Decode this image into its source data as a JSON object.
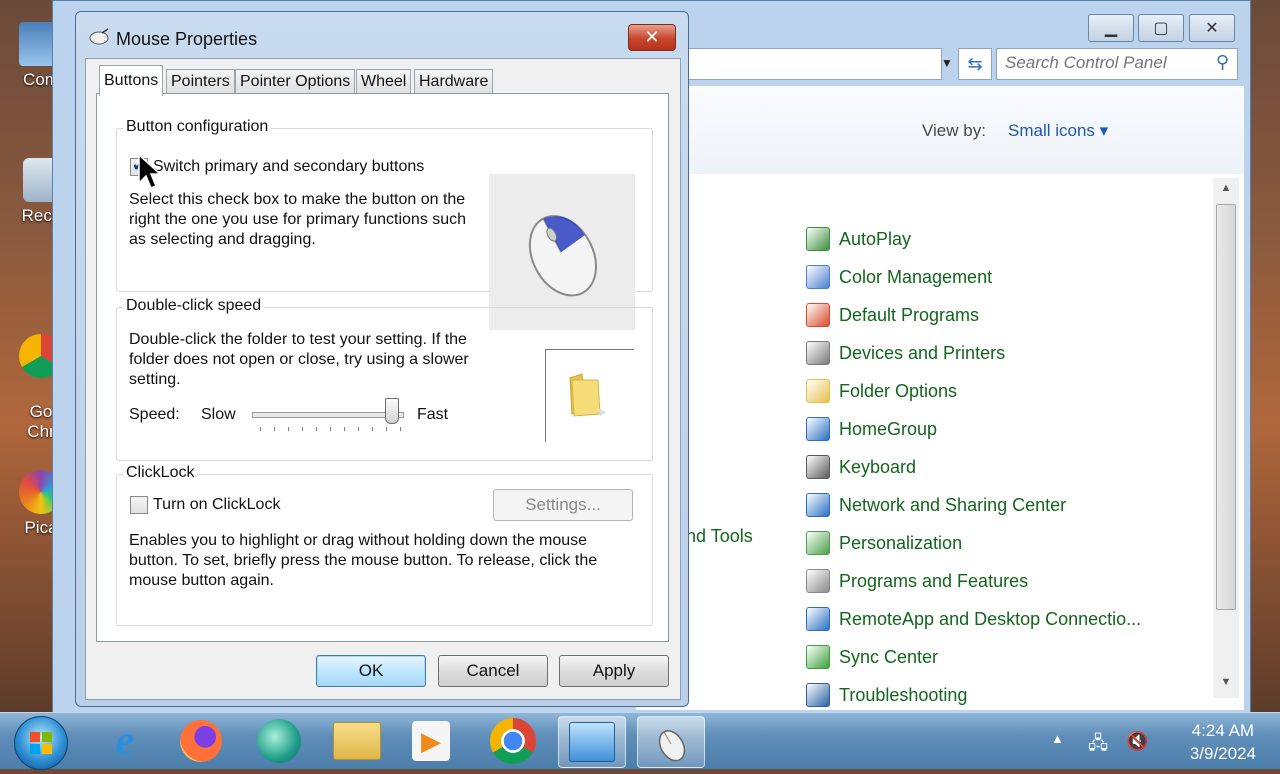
{
  "desktop": {
    "icons": [
      {
        "label": "Com"
      },
      {
        "label": "Recy"
      },
      {
        "label": "Go\nChr"
      },
      {
        "label": "Pica"
      }
    ]
  },
  "control_panel": {
    "search_placeholder": "Search Control Panel",
    "view_by_label": "View by:",
    "view_by_value": "Small icons ▾",
    "partial_item": "nd Tools",
    "items": [
      {
        "label": "AutoPlay",
        "icon": "autoplay-icon",
        "color": "#3a8f3a"
      },
      {
        "label": "Color Management",
        "icon": "color-management-icon",
        "color": "#4a7fd0"
      },
      {
        "label": "Default Programs",
        "icon": "default-programs-icon",
        "color": "#d94a2a"
      },
      {
        "label": "Devices and Printers",
        "icon": "devices-printers-icon",
        "color": "#7a7a7a"
      },
      {
        "label": "Folder Options",
        "icon": "folder-options-icon",
        "color": "#e7c04a"
      },
      {
        "label": "HomeGroup",
        "icon": "homegroup-icon",
        "color": "#2a6fc4"
      },
      {
        "label": "Keyboard",
        "icon": "keyboard-icon",
        "color": "#5a5a5a"
      },
      {
        "label": "Network and Sharing Center",
        "icon": "network-icon",
        "color": "#2a6fc4"
      },
      {
        "label": "Personalization",
        "icon": "personalization-icon",
        "color": "#4aa04a"
      },
      {
        "label": "Programs and Features",
        "icon": "programs-features-icon",
        "color": "#8a8a8a"
      },
      {
        "label": "RemoteApp and Desktop Connectio...",
        "icon": "remoteapp-icon",
        "color": "#2a6fc4"
      },
      {
        "label": "Sync Center",
        "icon": "sync-center-icon",
        "color": "#3aa03a"
      },
      {
        "label": "Troubleshooting",
        "icon": "troubleshooting-icon",
        "color": "#2a5fa4"
      }
    ]
  },
  "dialog": {
    "title": "Mouse Properties",
    "close_glyph": "✕",
    "tabs": [
      "Buttons",
      "Pointers",
      "Pointer Options",
      "Wheel",
      "Hardware"
    ],
    "active_tab": "Buttons",
    "button_config": {
      "title": "Button configuration",
      "checkbox_label": "Switch primary and secondary buttons",
      "checked": true,
      "description": "Select this check box to make the button on the right the one you use for primary functions such as selecting and dragging."
    },
    "double_click": {
      "title": "Double-click speed",
      "description": "Double-click the folder to test your setting. If the folder does not open or close, try using a slower setting.",
      "speed_label": "Speed:",
      "slow_label": "Slow",
      "fast_label": "Fast",
      "speed_value_fraction": 0.95
    },
    "clicklock": {
      "title": "ClickLock",
      "checkbox_label": "Turn on ClickLock",
      "checked": false,
      "settings_button": "Settings...",
      "description": "Enables you to highlight or drag without holding down the mouse button. To set, briefly press the mouse button. To release, click the mouse button again."
    },
    "buttons": {
      "ok": "OK",
      "cancel": "Cancel",
      "apply": "Apply"
    }
  },
  "taskbar": {
    "time": "4:24 AM",
    "date": "3/9/2024"
  }
}
